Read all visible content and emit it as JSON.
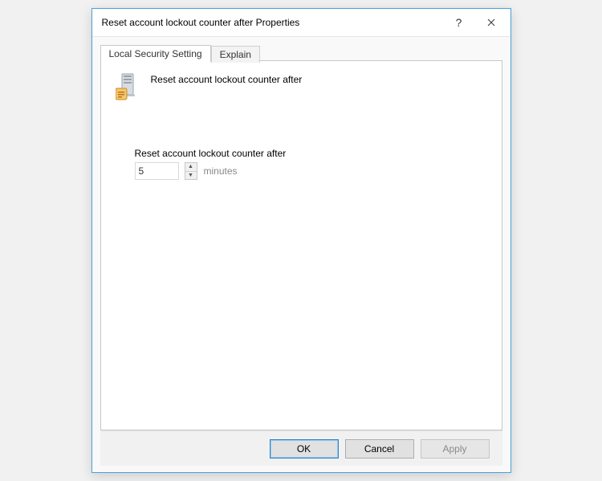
{
  "window": {
    "title": "Reset account lockout counter after Properties",
    "help_tooltip": "?",
    "close_tooltip": "Close"
  },
  "tabs": {
    "setting": "Local Security Setting",
    "explain": "Explain"
  },
  "content": {
    "policy_title": "Reset account lockout counter after",
    "field_label": "Reset account lockout counter after",
    "value": "5",
    "unit": "minutes"
  },
  "buttons": {
    "ok": "OK",
    "cancel": "Cancel",
    "apply": "Apply"
  }
}
